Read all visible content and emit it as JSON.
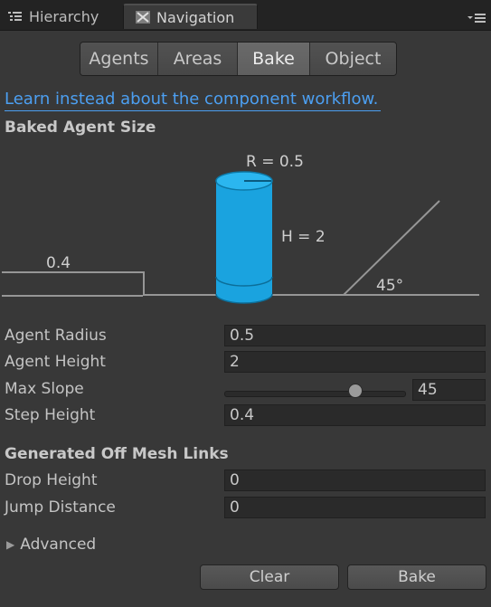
{
  "tabs": {
    "hierarchy_label": "Hierarchy",
    "navigation_label": "Navigation"
  },
  "segments": [
    {
      "label": "Agents",
      "selected": false
    },
    {
      "label": "Areas",
      "selected": false
    },
    {
      "label": "Bake",
      "selected": true
    },
    {
      "label": "Object",
      "selected": false
    }
  ],
  "link_text": "Learn instead about the component workflow.",
  "baked_section_title": "Baked Agent Size",
  "diagram": {
    "radius_label": "R = 0.5",
    "height_label": "H = 2",
    "step_label": "0.4",
    "slope_label": "45°",
    "agent_color": "#1aa3df"
  },
  "fields": {
    "agent_radius": {
      "label": "Agent Radius",
      "value": "0.5"
    },
    "agent_height": {
      "label": "Agent Height",
      "value": "2"
    },
    "max_slope": {
      "label": "Max Slope",
      "value": "45",
      "slider_min": 0,
      "slider_max": 60,
      "slider_value": 45
    },
    "step_height": {
      "label": "Step Height",
      "value": "0.4"
    }
  },
  "offmesh_section_title": "Generated Off Mesh Links",
  "offmesh": {
    "drop_height": {
      "label": "Drop Height",
      "value": "0"
    },
    "jump_distance": {
      "label": "Jump Distance",
      "value": "0"
    }
  },
  "advanced_label": "Advanced",
  "buttons": {
    "clear_label": "Clear",
    "bake_label": "Bake"
  }
}
